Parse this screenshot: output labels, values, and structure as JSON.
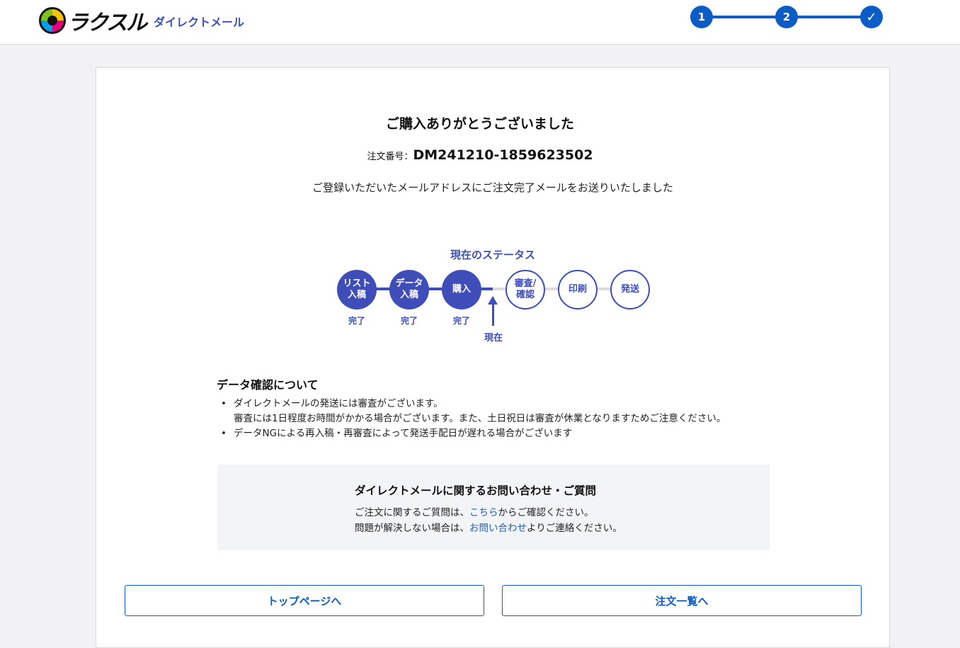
{
  "header": {
    "logo_text": "ラクスル",
    "service_name": "ダイレクトメール",
    "steps": [
      "1",
      "2",
      "✓"
    ]
  },
  "main": {
    "title": "ご購入ありがとうございました",
    "order_label": "注文番号：",
    "order_number": "DM241210-1859623502",
    "message": "ご登録いただいたメールアドレスにご注文完了メールをお送りいたしました"
  },
  "status": {
    "title": "現在のステータス",
    "steps": [
      {
        "line1": "リスト",
        "line2": "入稿",
        "state": "完了"
      },
      {
        "line1": "データ",
        "line2": "入稿",
        "state": "完了"
      },
      {
        "line1": "購入",
        "line2": "",
        "state": "完了"
      },
      {
        "line1": "審査/",
        "line2": "確認",
        "state": ""
      },
      {
        "line1": "印刷",
        "line2": "",
        "state": ""
      },
      {
        "line1": "発送",
        "line2": "",
        "state": ""
      }
    ],
    "current_label": "現在"
  },
  "notes": {
    "title": "データ確認について",
    "items": [
      "ダイレクトメールの発送には審査がございます。",
      "審査には1日程度お時間がかかる場合がございます。また、土日祝日は審査が休業となりますためご注意ください。",
      "データNGによる再入稿・再審査によって発送手配日が遅れる場合がございます"
    ]
  },
  "contact": {
    "title": "ダイレクトメールに関するお問い合わせ・ご質問",
    "line1_pre": "ご注文に関するご質問は、",
    "line1_link": "こちら",
    "line1_post": "からご確認ください。",
    "line2_pre": "問題が解決しない場合は、",
    "line2_link": "お問い合わせ",
    "line2_post": "よりご連絡ください。"
  },
  "buttons": {
    "top": "トップページへ",
    "orders": "注文一覧へ"
  },
  "colors": {
    "primary": "#0b5cc4",
    "status": "#3f4db8",
    "link": "#1e5fc6"
  }
}
